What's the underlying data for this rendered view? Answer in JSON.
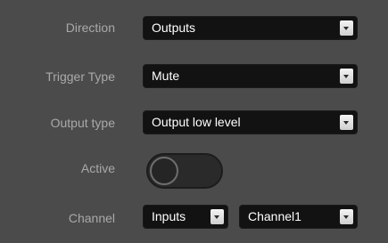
{
  "rows": {
    "direction": {
      "label": "Direction",
      "value": "Outputs"
    },
    "trigger_type": {
      "label": "Trigger Type",
      "value": "Mute"
    },
    "output_type": {
      "label": "Output type",
      "value": "Output low level"
    },
    "active": {
      "label": "Active",
      "state": "off"
    },
    "channel": {
      "label": "Channel",
      "source_value": "Inputs",
      "channel_value": "Channel1"
    }
  },
  "icons": {
    "dropdown": "chevron-down-icon"
  },
  "colors": {
    "background": "#4b4b4b",
    "label": "#a9a9a9",
    "field": "#121212",
    "field_text": "#ffffff"
  }
}
